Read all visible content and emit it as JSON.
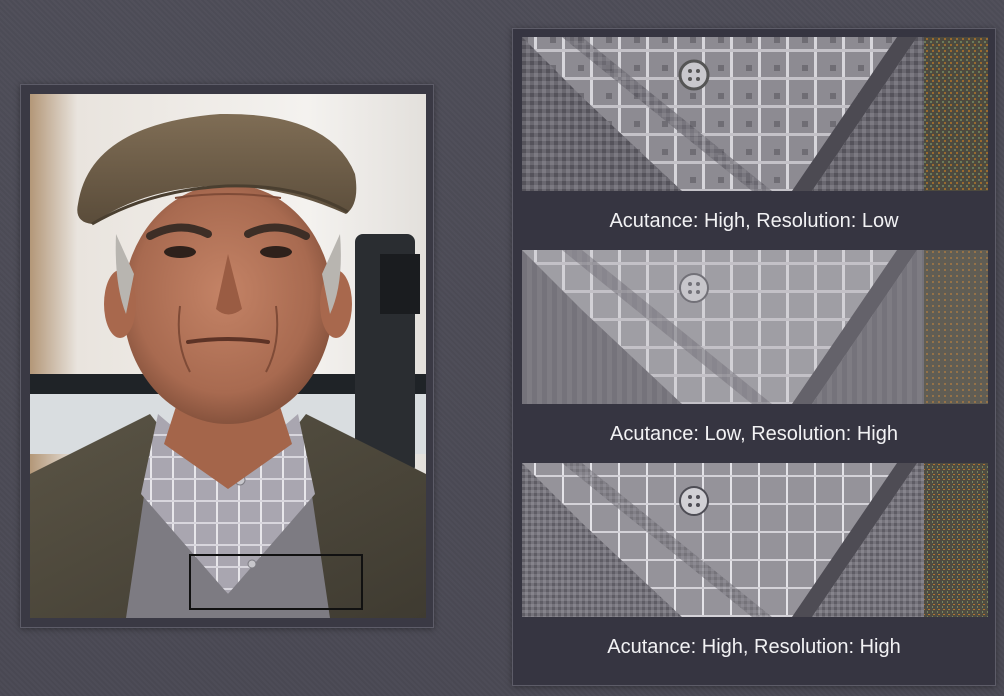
{
  "comparison": {
    "captions": [
      "Acutance: High, Resolution: Low",
      "Acutance: Low, Resolution: High",
      "Acutance: High, Resolution: High"
    ]
  },
  "colors": {
    "background": "#4b4a55",
    "panel": "#363541",
    "caption_text": "#f2f2f4"
  }
}
